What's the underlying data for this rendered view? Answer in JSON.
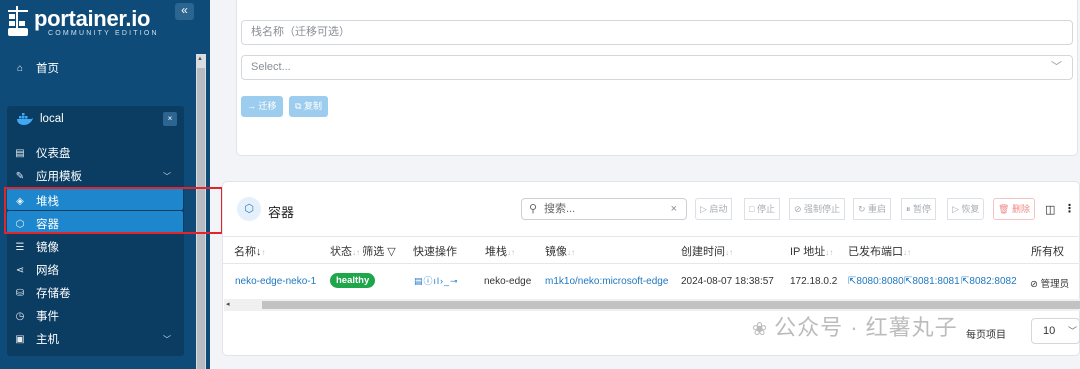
{
  "sidebar": {
    "brand": "portainer.io",
    "edition": "COMMUNITY EDITION",
    "collapse": "«",
    "home": "首页",
    "env_name": "local",
    "env_close": "×",
    "items": [
      {
        "label": "仪表盘",
        "icon": "dashboard-icon"
      },
      {
        "label": "应用模板",
        "icon": "edit-icon"
      },
      {
        "label": "堆栈",
        "icon": "layers-icon"
      },
      {
        "label": "容器",
        "icon": "cube-icon"
      },
      {
        "label": "镜像",
        "icon": "list-icon"
      },
      {
        "label": "网络",
        "icon": "share-icon"
      },
      {
        "label": "存储卷",
        "icon": "database-icon"
      },
      {
        "label": "事件",
        "icon": "clock-icon"
      },
      {
        "label": "主机",
        "icon": "server-icon"
      }
    ]
  },
  "migrate": {
    "stack_name_placeholder": "栈名称（迁移可选）",
    "select_placeholder": "Select...",
    "migrate_btn": "迁移",
    "duplicate_btn": "复制"
  },
  "containers": {
    "title": "容器",
    "search_placeholder": "搜索...",
    "actions": [
      "启动",
      "停止",
      "强制停止",
      "重启",
      "暂停",
      "恢复",
      "删除"
    ],
    "columns": {
      "name": "名称",
      "state": "状态",
      "filter": "筛选",
      "quick": "快速操作",
      "stack": "堆栈",
      "image": "镜像",
      "created": "创建时间",
      "ip": "IP 地址",
      "ports": "已发布端口",
      "owner": "所有权"
    },
    "rows": [
      {
        "name": "neko-edge-neko-1",
        "state": "healthy",
        "stack": "neko-edge",
        "image": "m1k1o/neko:microsoft-edge",
        "created": "2024-08-07 18:38:57",
        "ip": "172.18.0.2",
        "ports": [
          "8080:8080",
          "8081:8081",
          "8082:8082"
        ],
        "owner": "管理员"
      }
    ],
    "per_page_label": "每页项目",
    "per_page": "10"
  },
  "watermark": "公众号 · 红薯丸子",
  "colors": {
    "sidebar": "#0e4b78",
    "selected": "#1d86cc",
    "healthy": "#1fa64a",
    "link": "#1f78c1",
    "annotation": "#e0262b"
  }
}
